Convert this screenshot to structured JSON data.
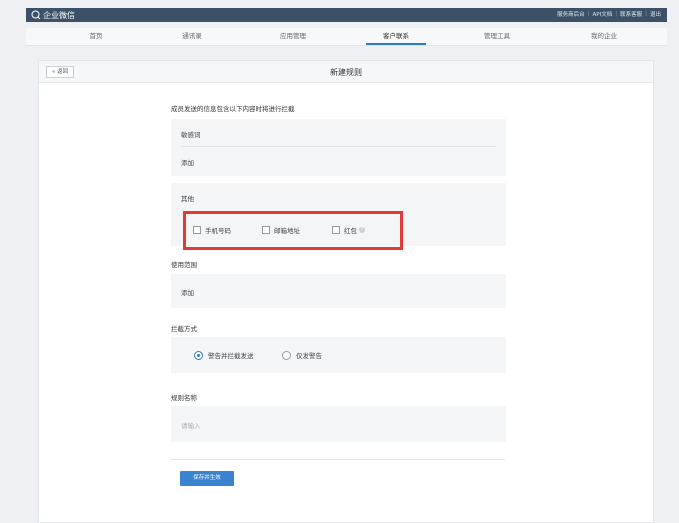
{
  "topbar": {
    "brand": "企业微信",
    "links": [
      "服务商后台",
      "API文档",
      "联系客服",
      "退出"
    ]
  },
  "nav": {
    "items": [
      {
        "label": "首页",
        "active": false
      },
      {
        "label": "通讯录",
        "active": false
      },
      {
        "label": "应用管理",
        "active": false
      },
      {
        "label": "客户联系",
        "active": true
      },
      {
        "label": "管理工具",
        "active": false
      },
      {
        "label": "我的企业",
        "active": false
      }
    ]
  },
  "page": {
    "back_label": "« 返回",
    "title": "新建规则"
  },
  "form": {
    "intercept_intro": "成员发送的信息包含以下内容时将进行拦截",
    "sensitive_words_label": "敏感词",
    "add_label": "添加",
    "other_label": "其他",
    "checkboxes": [
      {
        "label": "手机号码",
        "checked": false
      },
      {
        "label": "邮箱地址",
        "checked": false
      },
      {
        "label": "红包",
        "checked": false
      }
    ],
    "scope_label": "使用范围",
    "scope_add": "添加",
    "method_label": "拦截方式",
    "methods": [
      {
        "label": "警告并拦截发送",
        "checked": true
      },
      {
        "label": "仅发警告",
        "checked": false
      }
    ],
    "rule_name_label": "规则名称",
    "rule_name_placeholder": "请输入",
    "save_label": "保存并生效"
  },
  "colors": {
    "topbar": "#3c5168",
    "accent": "#3a83cf",
    "highlight": "#e53935"
  }
}
